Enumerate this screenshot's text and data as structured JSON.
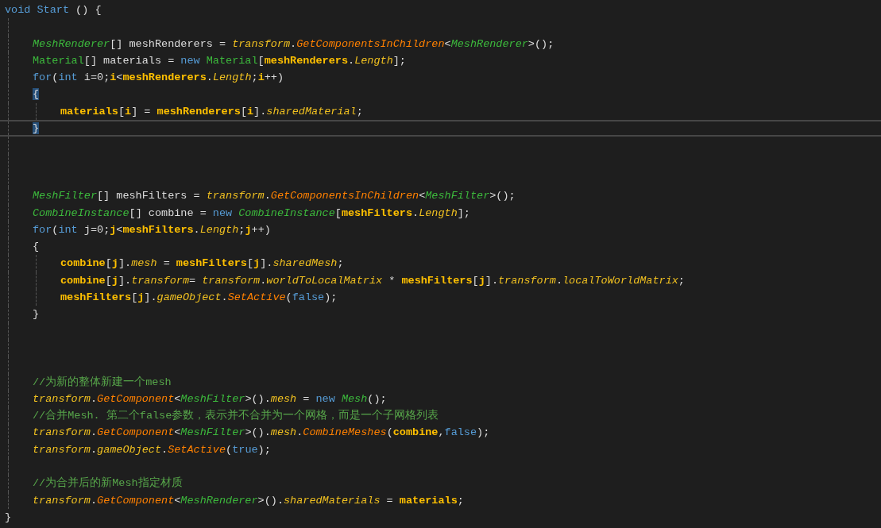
{
  "editor": {
    "lines": [
      {
        "kind": "code",
        "tokens": [
          {
            "kind": "keyword",
            "text": "void Start"
          },
          {
            "kind": "plain",
            "text": " () {"
          }
        ],
        "children": [
          {
            "kind": "blank"
          },
          {
            "kind": "code",
            "tokens": [
              {
                "kind": "type",
                "text": "MeshRenderer"
              },
              {
                "kind": "plain",
                "text": "[] meshRenderers = "
              },
              {
                "kind": "member",
                "text": "transform"
              },
              {
                "kind": "plain",
                "text": "."
              },
              {
                "kind": "method",
                "text": "GetComponentsInChildren"
              },
              {
                "kind": "plain",
                "text": "<"
              },
              {
                "kind": "type",
                "text": "MeshRenderer"
              },
              {
                "kind": "plain",
                "text": ">();"
              }
            ]
          },
          {
            "kind": "code",
            "tokens": [
              {
                "kind": "class",
                "text": "Material"
              },
              {
                "kind": "plain",
                "text": "[] materials = "
              },
              {
                "kind": "keyword",
                "text": "new"
              },
              {
                "kind": "class",
                "text": " Material"
              },
              {
                "kind": "plain",
                "text": "["
              },
              {
                "kind": "local",
                "text": "meshRenderers"
              },
              {
                "kind": "plain",
                "text": "."
              },
              {
                "kind": "member",
                "text": "Length"
              },
              {
                "kind": "plain",
                "text": "];"
              }
            ]
          },
          {
            "kind": "code",
            "tokens": [
              {
                "kind": "keyword",
                "text": "for"
              },
              {
                "kind": "plain",
                "text": "("
              },
              {
                "kind": "keyword",
                "text": "int"
              },
              {
                "kind": "plain",
                "text": " i=0;"
              },
              {
                "kind": "local",
                "text": "i"
              },
              {
                "kind": "plain",
                "text": "<"
              },
              {
                "kind": "local",
                "text": "meshRenderers"
              },
              {
                "kind": "plain",
                "text": "."
              },
              {
                "kind": "member",
                "text": "Length"
              },
              {
                "kind": "plain",
                "text": ";"
              },
              {
                "kind": "local",
                "text": "i"
              },
              {
                "kind": "plain",
                "text": "++)"
              }
            ]
          },
          {
            "kind": "code",
            "tokens": [
              {
                "kind": "brace",
                "text": "{"
              }
            ],
            "children": [
              {
                "kind": "code",
                "tokens": [
                  {
                    "kind": "local",
                    "text": "materials"
                  },
                  {
                    "kind": "plain",
                    "text": "["
                  },
                  {
                    "kind": "local",
                    "text": "i"
                  },
                  {
                    "kind": "plain",
                    "text": "] = "
                  },
                  {
                    "kind": "local",
                    "text": "meshRenderers"
                  },
                  {
                    "kind": "plain",
                    "text": "["
                  },
                  {
                    "kind": "local",
                    "text": "i"
                  },
                  {
                    "kind": "plain",
                    "text": "]."
                  },
                  {
                    "kind": "member",
                    "text": "sharedMaterial"
                  },
                  {
                    "kind": "plain",
                    "text": ";"
                  }
                ]
              }
            ]
          },
          {
            "kind": "code",
            "current": true,
            "tokens": [
              {
                "kind": "brace",
                "text": "}"
              }
            ]
          },
          {
            "kind": "blank"
          },
          {
            "kind": "blank"
          },
          {
            "kind": "blank"
          },
          {
            "kind": "code",
            "tokens": [
              {
                "kind": "type",
                "text": "MeshFilter"
              },
              {
                "kind": "plain",
                "text": "[] meshFilters = "
              },
              {
                "kind": "member",
                "text": "transform"
              },
              {
                "kind": "plain",
                "text": "."
              },
              {
                "kind": "method",
                "text": "GetComponentsInChildren"
              },
              {
                "kind": "plain",
                "text": "<"
              },
              {
                "kind": "type",
                "text": "MeshFilter"
              },
              {
                "kind": "plain",
                "text": ">();"
              }
            ]
          },
          {
            "kind": "code",
            "tokens": [
              {
                "kind": "type",
                "text": "CombineInstance"
              },
              {
                "kind": "plain",
                "text": "[] combine = "
              },
              {
                "kind": "keyword",
                "text": "new"
              },
              {
                "kind": "type",
                "text": " CombineInstance"
              },
              {
                "kind": "plain",
                "text": "["
              },
              {
                "kind": "local",
                "text": "meshFilters"
              },
              {
                "kind": "plain",
                "text": "."
              },
              {
                "kind": "member",
                "text": "Length"
              },
              {
                "kind": "plain",
                "text": "];"
              }
            ]
          },
          {
            "kind": "code",
            "tokens": [
              {
                "kind": "keyword",
                "text": "for"
              },
              {
                "kind": "plain",
                "text": "("
              },
              {
                "kind": "keyword",
                "text": "int"
              },
              {
                "kind": "plain",
                "text": " j=0;"
              },
              {
                "kind": "local",
                "text": "j"
              },
              {
                "kind": "plain",
                "text": "<"
              },
              {
                "kind": "local",
                "text": "meshFilters"
              },
              {
                "kind": "plain",
                "text": "."
              },
              {
                "kind": "member",
                "text": "Length"
              },
              {
                "kind": "plain",
                "text": ";"
              },
              {
                "kind": "local",
                "text": "j"
              },
              {
                "kind": "plain",
                "text": "++)"
              }
            ]
          },
          {
            "kind": "code",
            "tokens": [
              {
                "kind": "plain",
                "text": "{"
              }
            ],
            "children": [
              {
                "kind": "code",
                "tokens": [
                  {
                    "kind": "local",
                    "text": "combine"
                  },
                  {
                    "kind": "plain",
                    "text": "["
                  },
                  {
                    "kind": "local",
                    "text": "j"
                  },
                  {
                    "kind": "plain",
                    "text": "]."
                  },
                  {
                    "kind": "member",
                    "text": "mesh"
                  },
                  {
                    "kind": "plain",
                    "text": " = "
                  },
                  {
                    "kind": "local",
                    "text": "meshFilters"
                  },
                  {
                    "kind": "plain",
                    "text": "["
                  },
                  {
                    "kind": "local",
                    "text": "j"
                  },
                  {
                    "kind": "plain",
                    "text": "]."
                  },
                  {
                    "kind": "member",
                    "text": "sharedMesh"
                  },
                  {
                    "kind": "plain",
                    "text": ";"
                  }
                ]
              },
              {
                "kind": "code",
                "tokens": [
                  {
                    "kind": "local",
                    "text": "combine"
                  },
                  {
                    "kind": "plain",
                    "text": "["
                  },
                  {
                    "kind": "local",
                    "text": "j"
                  },
                  {
                    "kind": "plain",
                    "text": "]."
                  },
                  {
                    "kind": "member",
                    "text": "transform"
                  },
                  {
                    "kind": "plain",
                    "text": "= "
                  },
                  {
                    "kind": "member",
                    "text": "transform"
                  },
                  {
                    "kind": "plain",
                    "text": "."
                  },
                  {
                    "kind": "member",
                    "text": "worldToLocalMatrix"
                  },
                  {
                    "kind": "plain",
                    "text": " * "
                  },
                  {
                    "kind": "local",
                    "text": "meshFilters"
                  },
                  {
                    "kind": "plain",
                    "text": "["
                  },
                  {
                    "kind": "local",
                    "text": "j"
                  },
                  {
                    "kind": "plain",
                    "text": "]."
                  },
                  {
                    "kind": "member",
                    "text": "transform"
                  },
                  {
                    "kind": "plain",
                    "text": "."
                  },
                  {
                    "kind": "member",
                    "text": "localToWorldMatrix"
                  },
                  {
                    "kind": "plain",
                    "text": ";"
                  }
                ]
              },
              {
                "kind": "code",
                "tokens": [
                  {
                    "kind": "local",
                    "text": "meshFilters"
                  },
                  {
                    "kind": "plain",
                    "text": "["
                  },
                  {
                    "kind": "local",
                    "text": "j"
                  },
                  {
                    "kind": "plain",
                    "text": "]."
                  },
                  {
                    "kind": "member",
                    "text": "gameObject"
                  },
                  {
                    "kind": "plain",
                    "text": "."
                  },
                  {
                    "kind": "method",
                    "text": "SetActive"
                  },
                  {
                    "kind": "plain",
                    "text": "("
                  },
                  {
                    "kind": "keyword",
                    "text": "false"
                  },
                  {
                    "kind": "plain",
                    "text": ");"
                  }
                ]
              }
            ]
          },
          {
            "kind": "code",
            "tokens": [
              {
                "kind": "plain",
                "text": "}"
              }
            ]
          },
          {
            "kind": "blank"
          },
          {
            "kind": "blank"
          },
          {
            "kind": "blank"
          },
          {
            "kind": "code",
            "tokens": [
              {
                "kind": "comment",
                "text": "//为新的整体新建一个mesh"
              }
            ]
          },
          {
            "kind": "code",
            "tokens": [
              {
                "kind": "member",
                "text": "transform"
              },
              {
                "kind": "plain",
                "text": "."
              },
              {
                "kind": "method",
                "text": "GetComponent"
              },
              {
                "kind": "plain",
                "text": "<"
              },
              {
                "kind": "type",
                "text": "MeshFilter"
              },
              {
                "kind": "plain",
                "text": ">()."
              },
              {
                "kind": "member",
                "text": "mesh"
              },
              {
                "kind": "plain",
                "text": " = "
              },
              {
                "kind": "keyword",
                "text": "new"
              },
              {
                "kind": "type",
                "text": " Mesh"
              },
              {
                "kind": "plain",
                "text": "();"
              }
            ]
          },
          {
            "kind": "code",
            "tokens": [
              {
                "kind": "comment",
                "text": "//合并Mesh. 第二个false参数，表示并不合并为一个网格，而是一个子网格列表"
              }
            ]
          },
          {
            "kind": "code",
            "tokens": [
              {
                "kind": "member",
                "text": "transform"
              },
              {
                "kind": "plain",
                "text": "."
              },
              {
                "kind": "method",
                "text": "GetComponent"
              },
              {
                "kind": "plain",
                "text": "<"
              },
              {
                "kind": "type",
                "text": "MeshFilter"
              },
              {
                "kind": "plain",
                "text": ">()."
              },
              {
                "kind": "member",
                "text": "mesh"
              },
              {
                "kind": "plain",
                "text": "."
              },
              {
                "kind": "method",
                "text": "CombineMeshes"
              },
              {
                "kind": "plain",
                "text": "("
              },
              {
                "kind": "local",
                "text": "combine"
              },
              {
                "kind": "plain",
                "text": ","
              },
              {
                "kind": "keyword",
                "text": "false"
              },
              {
                "kind": "plain",
                "text": ");"
              }
            ]
          },
          {
            "kind": "code",
            "tokens": [
              {
                "kind": "member",
                "text": "transform"
              },
              {
                "kind": "plain",
                "text": "."
              },
              {
                "kind": "member",
                "text": "gameObject"
              },
              {
                "kind": "plain",
                "text": "."
              },
              {
                "kind": "method",
                "text": "SetActive"
              },
              {
                "kind": "plain",
                "text": "("
              },
              {
                "kind": "keyword",
                "text": "true"
              },
              {
                "kind": "plain",
                "text": ");"
              }
            ]
          },
          {
            "kind": "blank"
          },
          {
            "kind": "code",
            "tokens": [
              {
                "kind": "comment",
                "text": "//为合并后的新Mesh指定材质"
              }
            ]
          },
          {
            "kind": "code",
            "tokens": [
              {
                "kind": "member",
                "text": "transform"
              },
              {
                "kind": "plain",
                "text": "."
              },
              {
                "kind": "method",
                "text": "GetComponent"
              },
              {
                "kind": "plain",
                "text": "<"
              },
              {
                "kind": "type",
                "text": "MeshRenderer"
              },
              {
                "kind": "plain",
                "text": ">()."
              },
              {
                "kind": "member",
                "text": "sharedMaterials"
              },
              {
                "kind": "plain",
                "text": " = "
              },
              {
                "kind": "local",
                "text": "materials"
              },
              {
                "kind": "plain",
                "text": ";"
              }
            ]
          }
        ]
      },
      {
        "kind": "code",
        "tokens": [
          {
            "kind": "plain",
            "text": "}"
          }
        ]
      }
    ]
  }
}
